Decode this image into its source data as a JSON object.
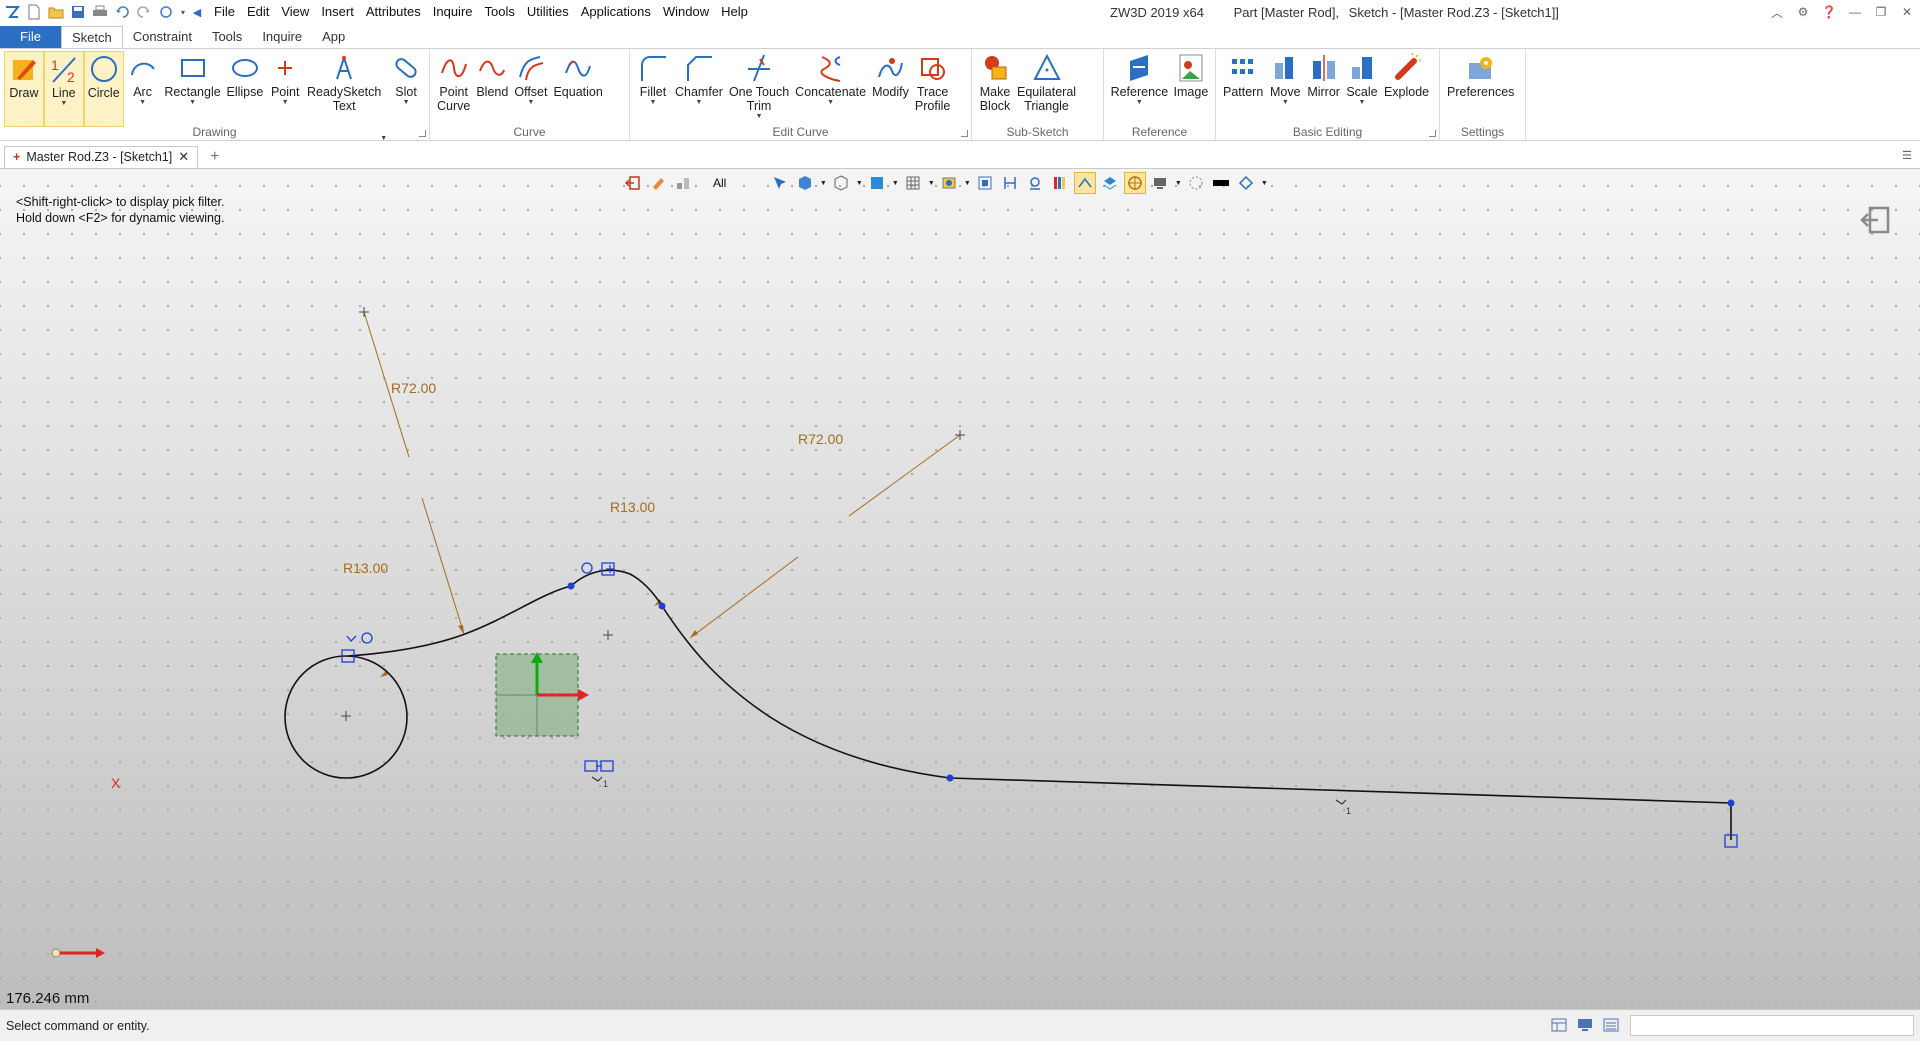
{
  "app": {
    "version_label": "ZW3D 2019  x64",
    "part_label": "Part [Master Rod],",
    "sketch_label": "Sketch - [Master Rod.Z3 - [Sketch1]]"
  },
  "menu": [
    "File",
    "Edit",
    "View",
    "Insert",
    "Attributes",
    "Inquire",
    "Tools",
    "Utilities",
    "Applications",
    "Window",
    "Help"
  ],
  "ribbon_tabs": [
    "File",
    "Sketch",
    "Constraint",
    "Tools",
    "Inquire",
    "App"
  ],
  "ribbon": {
    "drawing": {
      "label": "Drawing",
      "buttons": [
        {
          "label": "Draw",
          "icon": "draw-icon"
        },
        {
          "label": "Line",
          "icon": "line-icon"
        },
        {
          "label": "Circle",
          "icon": "circle-icon"
        },
        {
          "label": "Arc",
          "icon": "arc-icon"
        },
        {
          "label": "Rectangle",
          "icon": "rectangle-icon"
        },
        {
          "label": "Ellipse",
          "icon": "ellipse-icon"
        },
        {
          "label": "Point",
          "icon": "point-icon"
        },
        {
          "label": "ReadySketch\nText",
          "icon": "text-icon"
        },
        {
          "label": "Slot",
          "icon": "slot-icon"
        }
      ]
    },
    "curve": {
      "label": "Curve",
      "buttons": [
        {
          "label": "Point\nCurve",
          "icon": "point-curve-icon"
        },
        {
          "label": "Blend",
          "icon": "blend-icon"
        },
        {
          "label": "Offset",
          "icon": "offset-icon"
        },
        {
          "label": "Equation",
          "icon": "equation-icon"
        }
      ]
    },
    "edit_curve": {
      "label": "Edit Curve",
      "buttons": [
        {
          "label": "Fillet",
          "icon": "fillet-icon"
        },
        {
          "label": "Chamfer",
          "icon": "chamfer-icon"
        },
        {
          "label": "One Touch\nTrim",
          "icon": "trim-icon"
        },
        {
          "label": "Concatenate",
          "icon": "concatenate-icon"
        },
        {
          "label": "Modify",
          "icon": "modify-icon"
        },
        {
          "label": "Trace\nProfile",
          "icon": "trace-profile-icon"
        }
      ]
    },
    "sub_sketch": {
      "label": "Sub-Sketch",
      "buttons": [
        {
          "label": "Make\nBlock",
          "icon": "make-block-icon"
        },
        {
          "label": "Equilateral\nTriangle",
          "icon": "triangle-icon"
        }
      ]
    },
    "reference": {
      "label": "Reference",
      "buttons": [
        {
          "label": "Reference",
          "icon": "reference-icon"
        },
        {
          "label": "Image",
          "icon": "image-icon"
        }
      ]
    },
    "basic_editing": {
      "label": "Basic Editing",
      "buttons": [
        {
          "label": "Pattern",
          "icon": "pattern-icon"
        },
        {
          "label": "Move",
          "icon": "move-icon"
        },
        {
          "label": "Mirror",
          "icon": "mirror-icon"
        },
        {
          "label": "Scale",
          "icon": "scale-icon"
        },
        {
          "label": "Explode",
          "icon": "explode-icon"
        }
      ]
    },
    "settings": {
      "label": "Settings",
      "buttons": [
        {
          "label": "Preferences",
          "icon": "preferences-icon"
        }
      ]
    }
  },
  "document_tab": {
    "label": "Master Rod.Z3 - [Sketch1]"
  },
  "viewport": {
    "hint_line1": "<Shift-right-click> to display pick filter.",
    "hint_line2": "Hold down <F2> for dynamic viewing.",
    "pick_filter": "All",
    "dimensions": [
      "R72.00",
      "R72.00",
      "R13.00",
      "R13.00"
    ],
    "axis_label": "X",
    "scale_readout": "176.246 mm",
    "constraint_subscripts": [
      "1",
      "1"
    ]
  },
  "status": {
    "text": "Select command or entity.",
    "input_value": ""
  },
  "colors": {
    "accent": "#2b6fc2",
    "dimension": "#a46b1a",
    "constraint": "#1f3fd6",
    "sketch_curve": "#111111"
  }
}
